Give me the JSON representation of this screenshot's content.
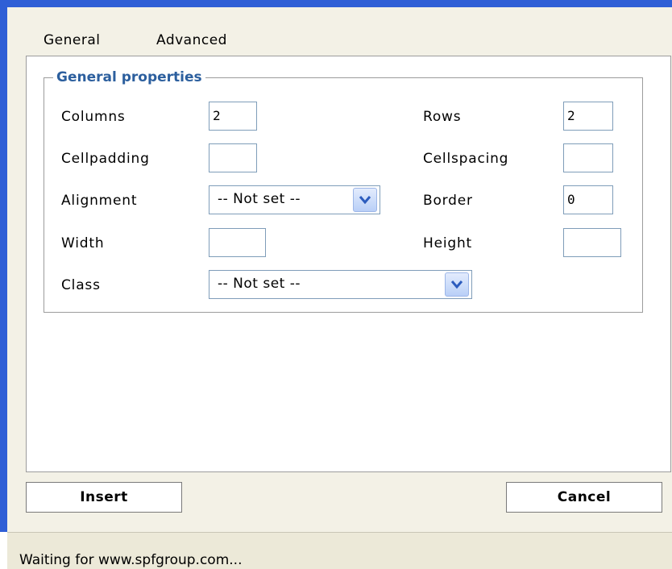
{
  "tabs": [
    "General",
    "Advanced"
  ],
  "fieldset": {
    "legend": "General properties"
  },
  "fields": {
    "columns": {
      "label": "Columns",
      "value": "2"
    },
    "rows": {
      "label": "Rows",
      "value": "2"
    },
    "cellpadding": {
      "label": "Cellpadding",
      "value": ""
    },
    "cellspacing": {
      "label": "Cellspacing",
      "value": ""
    },
    "alignment": {
      "label": "Alignment",
      "value": "-- Not set --"
    },
    "border": {
      "label": "Border",
      "value": "0"
    },
    "width": {
      "label": "Width",
      "value": ""
    },
    "height": {
      "label": "Height",
      "value": ""
    },
    "class": {
      "label": "Class",
      "value": "-- Not set --"
    }
  },
  "buttons": {
    "insert": "Insert",
    "cancel": "Cancel"
  },
  "status": {
    "text": "Waiting for www.spfgroup.com..."
  },
  "colors": {
    "accent_border": "#2f5fd6",
    "legend": "#2c5f9e"
  },
  "icons": {
    "dropdown": "chevron-down-icon"
  }
}
